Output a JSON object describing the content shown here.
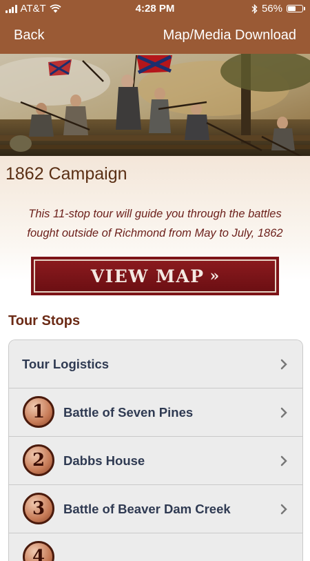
{
  "status_bar": {
    "carrier": "AT&T",
    "time": "4:28 PM",
    "battery_percent": "56%",
    "battery_level": 0.56
  },
  "nav": {
    "back_label": "Back",
    "download_label": "Map/Media Download"
  },
  "page": {
    "title": "1862 Campaign",
    "intro": "This 11-stop tour will guide you through the battles fought outside of Richmond from May to July, 1862",
    "view_map_label": "VIEW MAP",
    "view_map_arrows": "»",
    "stops_heading": "Tour Stops"
  },
  "stops": [
    {
      "number": "",
      "label": "Tour Logistics"
    },
    {
      "number": "1",
      "label": "Battle of Seven Pines"
    },
    {
      "number": "2",
      "label": "Dabbs House"
    },
    {
      "number": "3",
      "label": "Battle of Beaver Dam Creek"
    },
    {
      "number": "4",
      "label": ""
    }
  ],
  "colors": {
    "nav_bar": "#9a5a35",
    "title": "#5a2f14",
    "intro_text": "#6b1f1a",
    "view_map_button": "#7d1418",
    "row_text": "#2f3a52",
    "row_background": "#ececec"
  },
  "icons": {
    "wifi": "wifi-icon",
    "bluetooth": "bluetooth-icon",
    "battery": "battery-icon",
    "chevron": "chevron-right-icon",
    "stop_badge": "numbered-medallion-icon"
  }
}
